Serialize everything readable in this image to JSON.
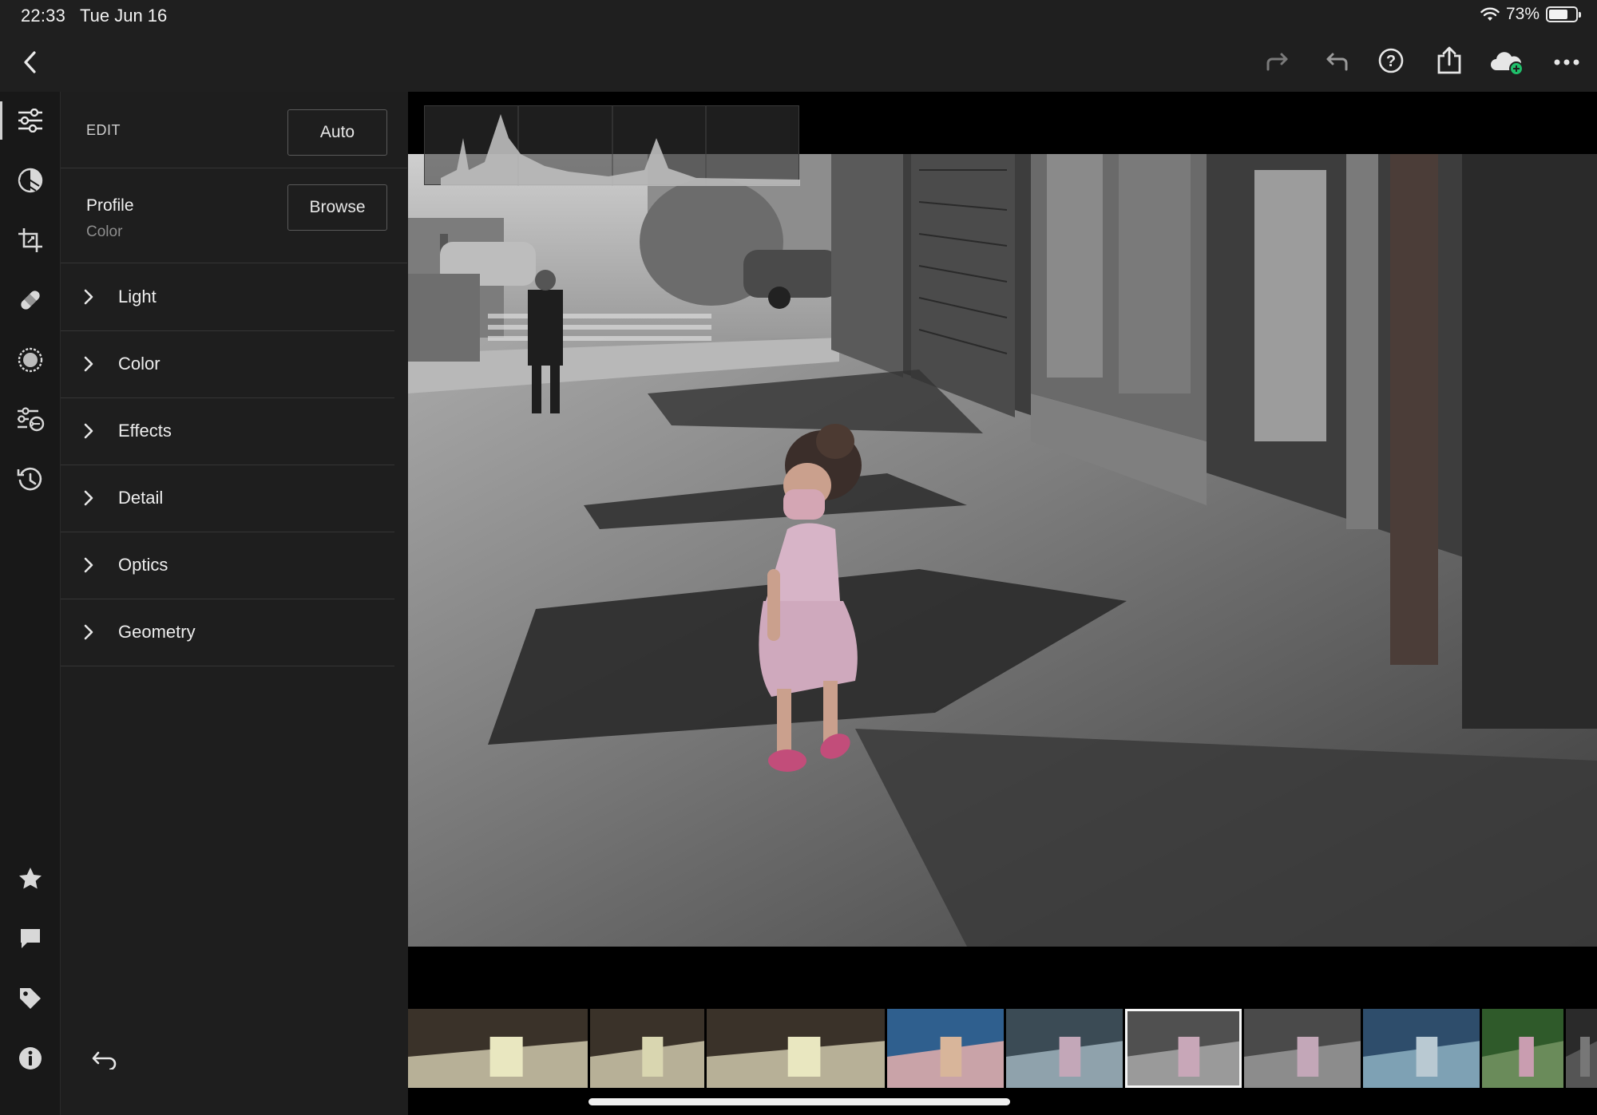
{
  "status": {
    "time": "22:33",
    "date": "Tue Jun 16",
    "battery": "73%",
    "battery_level": 0.73
  },
  "toolbar": {
    "back_icon": "chevron-left-icon",
    "icons": [
      "redo-icon",
      "undo-icon",
      "help-icon",
      "share-icon",
      "cloud-sync-icon",
      "more-icon"
    ]
  },
  "rail": {
    "items": [
      "edit-sliders-icon",
      "presets-icon",
      "crop-icon",
      "healing-icon",
      "masking-icon",
      "versions-icon",
      "history-icon"
    ],
    "bottom_items": [
      "star-icon",
      "comment-icon",
      "tag-icon",
      "info-icon"
    ]
  },
  "edit": {
    "title": "EDIT",
    "auto_label": "Auto",
    "profile_label": "Profile",
    "profile_value": "Color",
    "browse_label": "Browse",
    "sections": [
      "Light",
      "Color",
      "Effects",
      "Detail",
      "Optics",
      "Geometry"
    ]
  },
  "filmstrip": {
    "count": 10,
    "selected_index": 5
  },
  "colors": {
    "accent_cloud": "#1fbf6a",
    "panel_bg": "#1e1e1e",
    "rail_bg": "#181818"
  }
}
